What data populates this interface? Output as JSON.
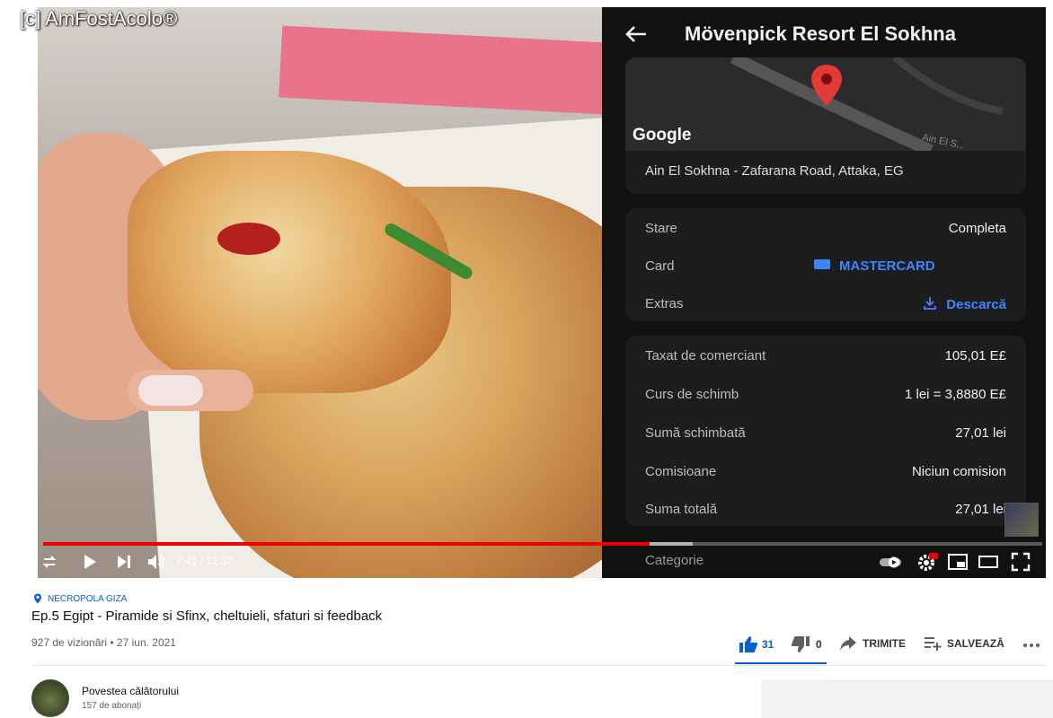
{
  "watermark": "[c] AmFostAcolo®",
  "player": {
    "phone": {
      "title": "Mövenpick Resort El Sokhna",
      "map_brand": "Google",
      "road_label": "Ain El S...",
      "address": "Ain El Sokhna - Zafarana Road, Attaka, EG",
      "status": {
        "label": "Stare",
        "value": "Completa"
      },
      "card": {
        "label": "Card",
        "value": "MASTERCARD"
      },
      "statement": {
        "label": "Extras",
        "value": "Descarcă"
      },
      "details": [
        {
          "label": "Taxat de comerciant",
          "value": "105,01 E£"
        },
        {
          "label": "Curs de schimb",
          "value": "1 lei = 3,8880 E£"
        },
        {
          "label": "Sumă schimbată",
          "value": "27,01 lei"
        },
        {
          "label": "Comisioane",
          "value": "Niciun comision"
        },
        {
          "label": "Suma totală",
          "value": "27,01 lei"
        }
      ],
      "category_label": "Categorie",
      "accent": "#3d86ff"
    },
    "time": "7:41 / 12:37",
    "progress": 0.607,
    "buffered": 0.65,
    "progress_color": "#ee0000"
  },
  "video": {
    "location": "NECROPOLA GIZA",
    "title": "Ep.5 Egipt - Piramide si Sfinx, cheltuieli, sfaturi si feedback",
    "meta": "927 de vizionări • 27 iun. 2021",
    "likes": "31",
    "dislikes": "0",
    "share_label": "TRIMITE",
    "save_label": "SALVEAZĂ"
  },
  "channel": {
    "name": "Povestea călătorului",
    "subscribers": "157 de abonați"
  }
}
